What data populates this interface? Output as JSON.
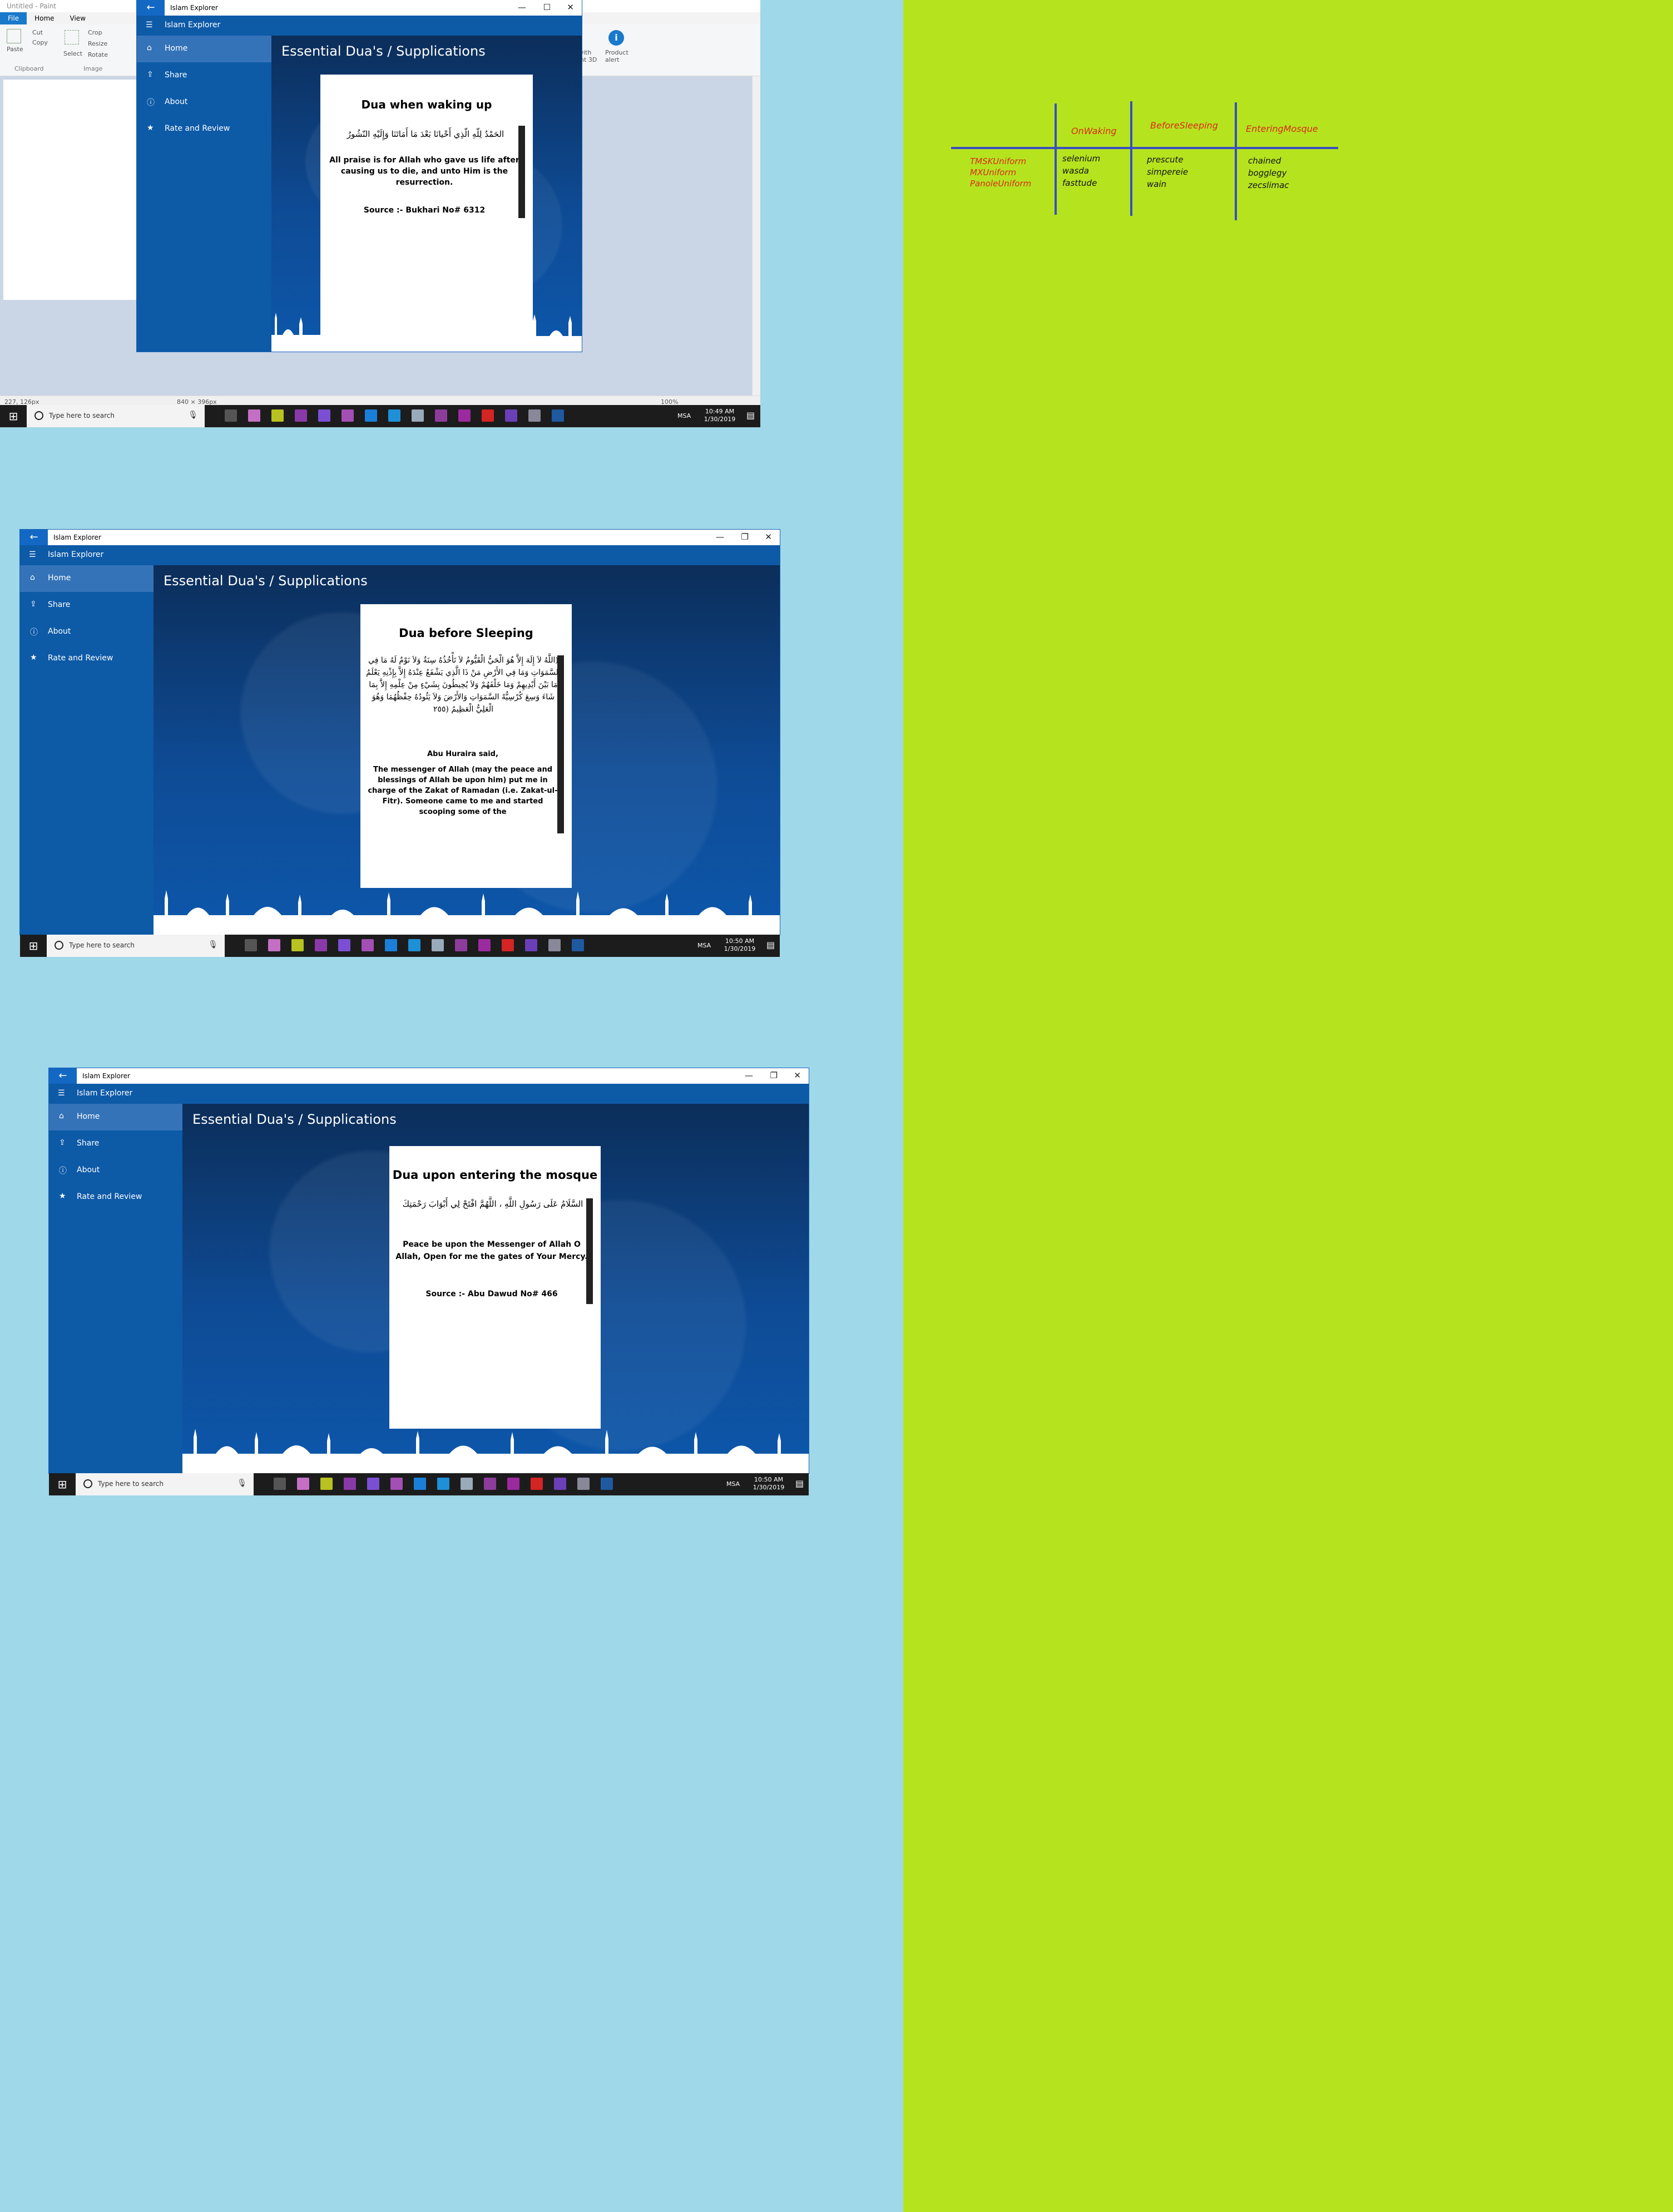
{
  "paint": {
    "title": "Untitled - Paint",
    "tabs": [
      "File",
      "Home",
      "View"
    ],
    "ribbon": {
      "paste": "Paste",
      "cut": "Cut",
      "copy": "Copy",
      "select": "Select",
      "crop": "Crop",
      "resize": "Resize",
      "rotate": "Rotate",
      "clipboard_group": "Clipboard",
      "image_group": "Image",
      "edit3d": "with\nint 3D",
      "product_alert": "Product\nalert"
    },
    "status": {
      "cursor": "227, 126px",
      "size": "840 × 396px",
      "zoom": "100%"
    }
  },
  "app": {
    "window_title": "Islam Explorer",
    "app_name": "Islam Explorer",
    "page_title": "Essential Dua's / Supplications",
    "nav": [
      {
        "label": "Home",
        "icon": "home-icon"
      },
      {
        "label": "Share",
        "icon": "share-icon"
      },
      {
        "label": "About",
        "icon": "info-icon"
      },
      {
        "label": "Rate and Review",
        "icon": "star-icon"
      }
    ]
  },
  "shots": [
    {
      "card_title": "Dua when waking up",
      "arabic": "الحَمْدُ لِلّهِ الّذِي أَحْيانَا بَعْدَ مَا أَمَاتَنَا وَإِلَيْهِ النّشُورُ",
      "english": "All praise is for Allah who gave us life after causing us to die, and unto Him is the resurrection.",
      "source": "Source :- Bukhari No# 6312",
      "clock_time": "10:49 AM",
      "clock_date": "1/30/2019"
    },
    {
      "card_title": "Dua before Sleeping",
      "arabic": "(اللَّهُ لاَ إِلَهَ إِلاَّ هُوَ الْحَيُّ الْقَيُّومُ لاَ تَأْخُذُهُ سِنَةٌ وَلاَ نَوْمٌ لَهُ مَا فِي السَّمَوَاتِ وَمَا فِي الأَرْضِ مَنْ ذَا الَّذِي يَشْفَعُ عِنْدَهُ إِلاَّ بِإِذْنِهِ يَعْلَمُ مَا بَيْنَ أَيْدِيهِمْ وَمَا خَلْفَهُمْ وَلاَ يُحِيطُونَ بِشَيْءٍ مِنْ عِلْمِهِ إِلاَّ بِمَا شَاءَ وَسِعَ كُرْسِيُّهُ السَّمَوَاتِ وَالأَرْضَ وَلاَ يَئُودُهُ حِفْظُهُمَا وَهُوَ الْعَلِيُّ الْعَظِيمُ (٢٥٥",
      "narrator": "Abu Huraira said,",
      "english": "The messenger of Allah (may the peace and blessings of Allah be upon him) put me in charge of the Zakat of Ramadan (i.e. Zakat-ul-Fitr). Someone came to me and started scooping some of the",
      "clock_time": "10:50 AM",
      "clock_date": "1/30/2019"
    },
    {
      "card_title": "Dua upon entering the mosque",
      "arabic": "السَّلَامُ عَلَى رَسُولِ اللَّهِ ، اللَّهُمَّ افْتَحْ لِي أَبْوَابَ رَحْمَتِكَ",
      "english": "Peace be upon the Messenger of Allah O Allah, Open for me the gates of Your Mercy.",
      "source": "Source :- Abu Dawud No# 466",
      "clock_time": "10:50 AM",
      "clock_date": "1/30/2019"
    }
  ],
  "taskbar": {
    "search_placeholder": "Type here to search",
    "language": "MSA"
  },
  "board": {
    "headers": [
      "OnWaking",
      "BeforeSleeping",
      "EnteringMosque"
    ],
    "row_labels": [
      "TMSKUniform",
      "MXUniform",
      "PanoleUniform"
    ],
    "col1": [
      "selenium",
      "wasda",
      "fasttude"
    ],
    "col2": [
      "prescute",
      "simpereie",
      "wain"
    ],
    "col3": [
      "chained",
      "bogglegy",
      "zecslimac"
    ]
  },
  "colors": {
    "accent": "#0d5aa7",
    "nav_active": "#3573b8",
    "board_ink_red": "#d92a1a",
    "board_ink_blue": "#3a4fbf"
  }
}
